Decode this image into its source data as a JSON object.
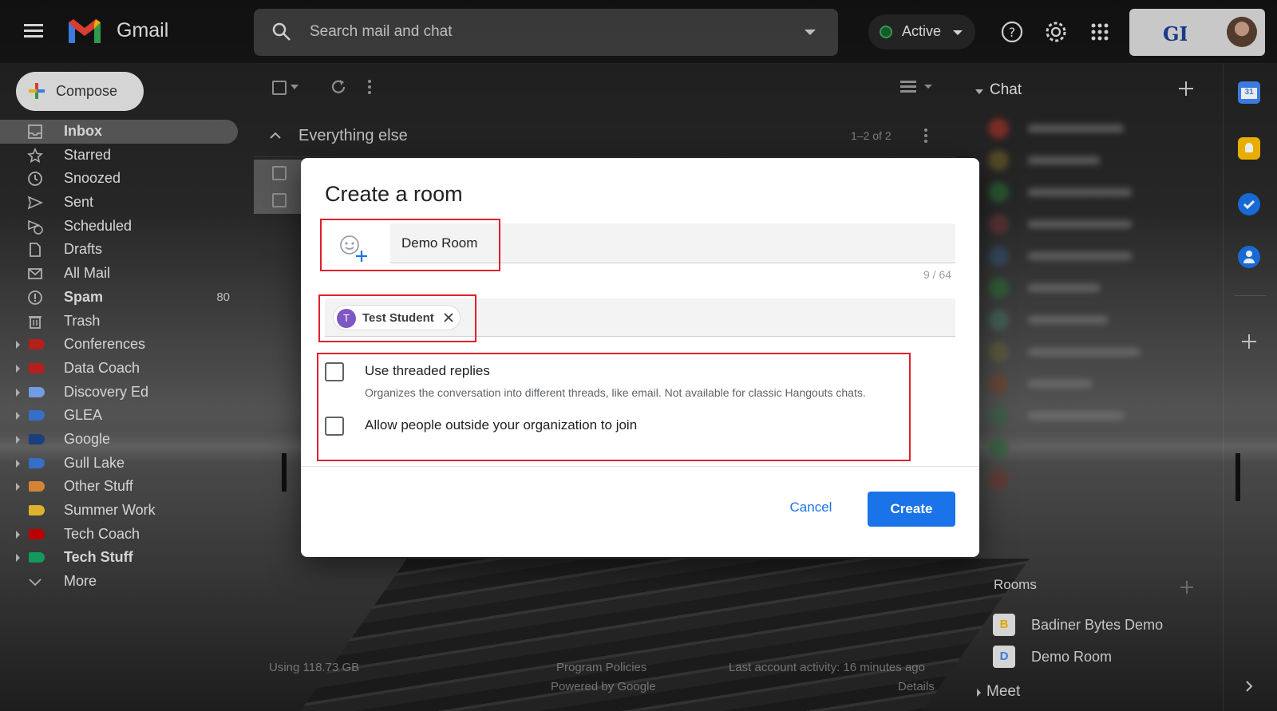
{
  "app": {
    "title": "Gmail"
  },
  "search": {
    "placeholder": "Search mail and chat"
  },
  "status": {
    "label": "Active",
    "color": "#34a853"
  },
  "compose": {
    "label": "Compose"
  },
  "nav": {
    "items": [
      {
        "label": "Inbox",
        "icon": "inbox-icon",
        "bold": true,
        "active": true
      },
      {
        "label": "Starred",
        "icon": "star-icon"
      },
      {
        "label": "Snoozed",
        "icon": "clock-icon"
      },
      {
        "label": "Sent",
        "icon": "send-icon"
      },
      {
        "label": "Scheduled",
        "icon": "scheduled-icon"
      },
      {
        "label": "Drafts",
        "icon": "draft-icon"
      },
      {
        "label": "All Mail",
        "icon": "mail-icon"
      },
      {
        "label": "Spam",
        "icon": "spam-icon",
        "bold": true,
        "count": "80"
      },
      {
        "label": "Trash",
        "icon": "trash-icon"
      },
      {
        "label": "Conferences",
        "color": "#c5221f",
        "expandable": true
      },
      {
        "label": "Data Coach",
        "color": "#c5221f",
        "expandable": true
      },
      {
        "label": "Discovery Ed",
        "color": "#7baaf7",
        "expandable": true
      },
      {
        "label": "GLEA",
        "color": "#3c78d8",
        "expandable": true
      },
      {
        "label": "Google",
        "color": "#1c4587",
        "expandable": true
      },
      {
        "label": "Gull Lake",
        "color": "#3c78d8",
        "expandable": true
      },
      {
        "label": "Other Stuff",
        "color": "#e69138",
        "expandable": true
      },
      {
        "label": "Summer Work",
        "color": "#f1c232"
      },
      {
        "label": "Tech Coach",
        "color": "#cc0000",
        "expandable": true
      },
      {
        "label": "Tech Stuff",
        "color": "#16a765",
        "expandable": true,
        "bold": true
      },
      {
        "label": "More",
        "icon": "chevron-down-icon"
      }
    ]
  },
  "list": {
    "section_title": "Everything else",
    "range": "1–2 of 2"
  },
  "chat": {
    "title": "Chat",
    "rooms_title": "Rooms",
    "rooms": [
      {
        "initial": "B",
        "name": "Badiner Bytes Demo",
        "color": "#f4b400"
      },
      {
        "initial": "D",
        "name": "Demo Room",
        "color": "#4285f4"
      }
    ],
    "meet_title": "Meet"
  },
  "footer": {
    "storage": "Using 118.73 GB",
    "policies": "Program Policies",
    "powered": "Powered by Google",
    "activity": "Last account activity: 16 minutes ago",
    "details": "Details"
  },
  "dialog": {
    "title": "Create a room",
    "room_name": "Demo Room",
    "char_count": "9 / 64",
    "person": {
      "initial": "T",
      "name": "Test Student"
    },
    "option1": {
      "label": "Use threaded replies",
      "desc": "Organizes the conversation into different threads, like email. Not available for classic Hangouts chats."
    },
    "option2": {
      "label": "Allow people outside your organization to join"
    },
    "cancel_label": "Cancel",
    "create_label": "Create",
    "accent": "#1a73e8"
  }
}
